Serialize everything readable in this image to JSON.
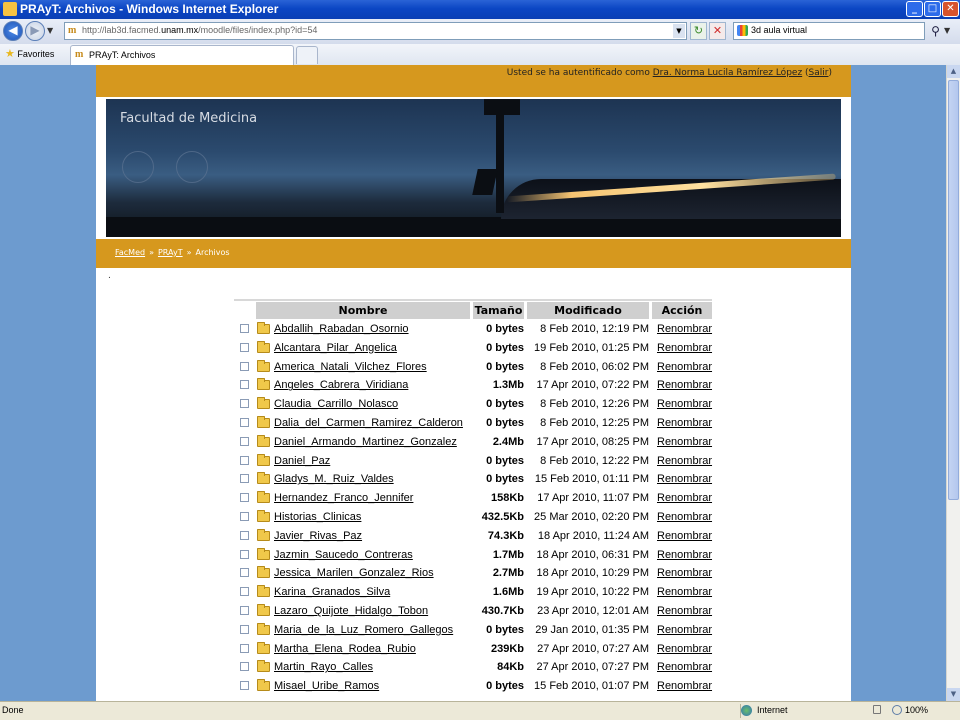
{
  "window": {
    "title": "PRAyT: Archivos - Windows Internet Explorer"
  },
  "toolbar": {
    "url_prefix": "http://lab3d.facmed.",
    "url_domain": "unam.mx",
    "url_suffix": "/moodle/files/index.php?id=54",
    "search_text": "3d aula virtual",
    "favorites_label": "Favorites",
    "tab_label": "PRAyT: Archivos"
  },
  "page": {
    "login_prefix": "Usted se ha autentificado como ",
    "login_user": "Dra. Norma Lucila Ramírez López",
    "login_open": " (",
    "logout_label": "Salir",
    "login_close": ")",
    "banner_title": "Facultad de Medicina",
    "breadcrumb": [
      "FacMed",
      "PRAyT",
      "Archivos"
    ],
    "breadcrumb_sep": "»",
    "dot": "."
  },
  "file_table": {
    "columns": [
      "Nombre",
      "Tamaño",
      "Modificado",
      "Acción"
    ],
    "rows": [
      {
        "name": "Abdallih_Rabadan_Osornio",
        "size": "0 bytes",
        "modified": "8 Feb 2010, 12:19 PM",
        "action": "Renombrar"
      },
      {
        "name": "Alcantara_Pilar_Angelica",
        "size": "0 bytes",
        "modified": "19 Feb 2010, 01:25 PM",
        "action": "Renombrar"
      },
      {
        "name": "America_Natali_Vilchez_Flores",
        "size": "0 bytes",
        "modified": "8 Feb 2010, 06:02 PM",
        "action": "Renombrar"
      },
      {
        "name": "Angeles_Cabrera_Viridiana",
        "size": "1.3Mb",
        "modified": "17 Apr 2010, 07:22 PM",
        "action": "Renombrar"
      },
      {
        "name": "Claudia_Carrillo_Nolasco",
        "size": "0 bytes",
        "modified": "8 Feb 2010, 12:26 PM",
        "action": "Renombrar"
      },
      {
        "name": "Dalia_del_Carmen_Ramirez_Calderon",
        "size": "0 bytes",
        "modified": "8 Feb 2010, 12:25 PM",
        "action": "Renombrar"
      },
      {
        "name": "Daniel_Armando_Martinez_Gonzalez",
        "size": "2.4Mb",
        "modified": "17 Apr 2010, 08:25 PM",
        "action": "Renombrar"
      },
      {
        "name": "Daniel_Paz",
        "size": "0 bytes",
        "modified": "8 Feb 2010, 12:22 PM",
        "action": "Renombrar"
      },
      {
        "name": "Gladys_M._Ruiz_Valdes",
        "size": "0 bytes",
        "modified": "15 Feb 2010, 01:11 PM",
        "action": "Renombrar"
      },
      {
        "name": "Hernandez_Franco_Jennifer",
        "size": "158Kb",
        "modified": "17 Apr 2010, 11:07 PM",
        "action": "Renombrar"
      },
      {
        "name": "Historias_Clinicas",
        "size": "432.5Kb",
        "modified": "25 Mar 2010, 02:20 PM",
        "action": "Renombrar"
      },
      {
        "name": "Javier_Rivas_Paz",
        "size": "74.3Kb",
        "modified": "18 Apr 2010, 11:24 AM",
        "action": "Renombrar"
      },
      {
        "name": "Jazmin_Saucedo_Contreras",
        "size": "1.7Mb",
        "modified": "18 Apr 2010, 06:31 PM",
        "action": "Renombrar"
      },
      {
        "name": "Jessica_Marilen_Gonzalez_Rios",
        "size": "2.7Mb",
        "modified": "18 Apr 2010, 10:29 PM",
        "action": "Renombrar"
      },
      {
        "name": "Karina_Granados_Silva",
        "size": "1.6Mb",
        "modified": "19 Apr 2010, 10:22 PM",
        "action": "Renombrar"
      },
      {
        "name": "Lazaro_Quijote_Hidalgo_Tobon",
        "size": "430.7Kb",
        "modified": "23 Apr 2010, 12:01 AM",
        "action": "Renombrar"
      },
      {
        "name": "Maria_de_la_Luz_Romero_Gallegos",
        "size": "0 bytes",
        "modified": "29 Jan 2010, 01:35 PM",
        "action": "Renombrar"
      },
      {
        "name": "Martha_Elena_Rodea_Rubio",
        "size": "239Kb",
        "modified": "27 Apr 2010, 07:27 AM",
        "action": "Renombrar"
      },
      {
        "name": "Martin_Rayo_Calles",
        "size": "84Kb",
        "modified": "27 Apr 2010, 07:27 PM",
        "action": "Renombrar"
      },
      {
        "name": "Misael_Uribe_Ramos",
        "size": "0 bytes",
        "modified": "15 Feb 2010, 01:07 PM",
        "action": "Renombrar"
      }
    ]
  },
  "status": {
    "text": "Done",
    "zone": "Internet",
    "zoom": "100%"
  },
  "colors": {
    "accent_gold": "#d6981e",
    "page_bg": "#6d9bcf",
    "header_gray": "#cfcfcf"
  },
  "icons": [
    "ie-icon",
    "back-icon",
    "forward-icon",
    "refresh-icon",
    "stop-icon",
    "google-search-icon",
    "search-icon",
    "favorites-star-icon",
    "folder-icon",
    "globe-icon",
    "lock-icon",
    "zoom-icon"
  ]
}
